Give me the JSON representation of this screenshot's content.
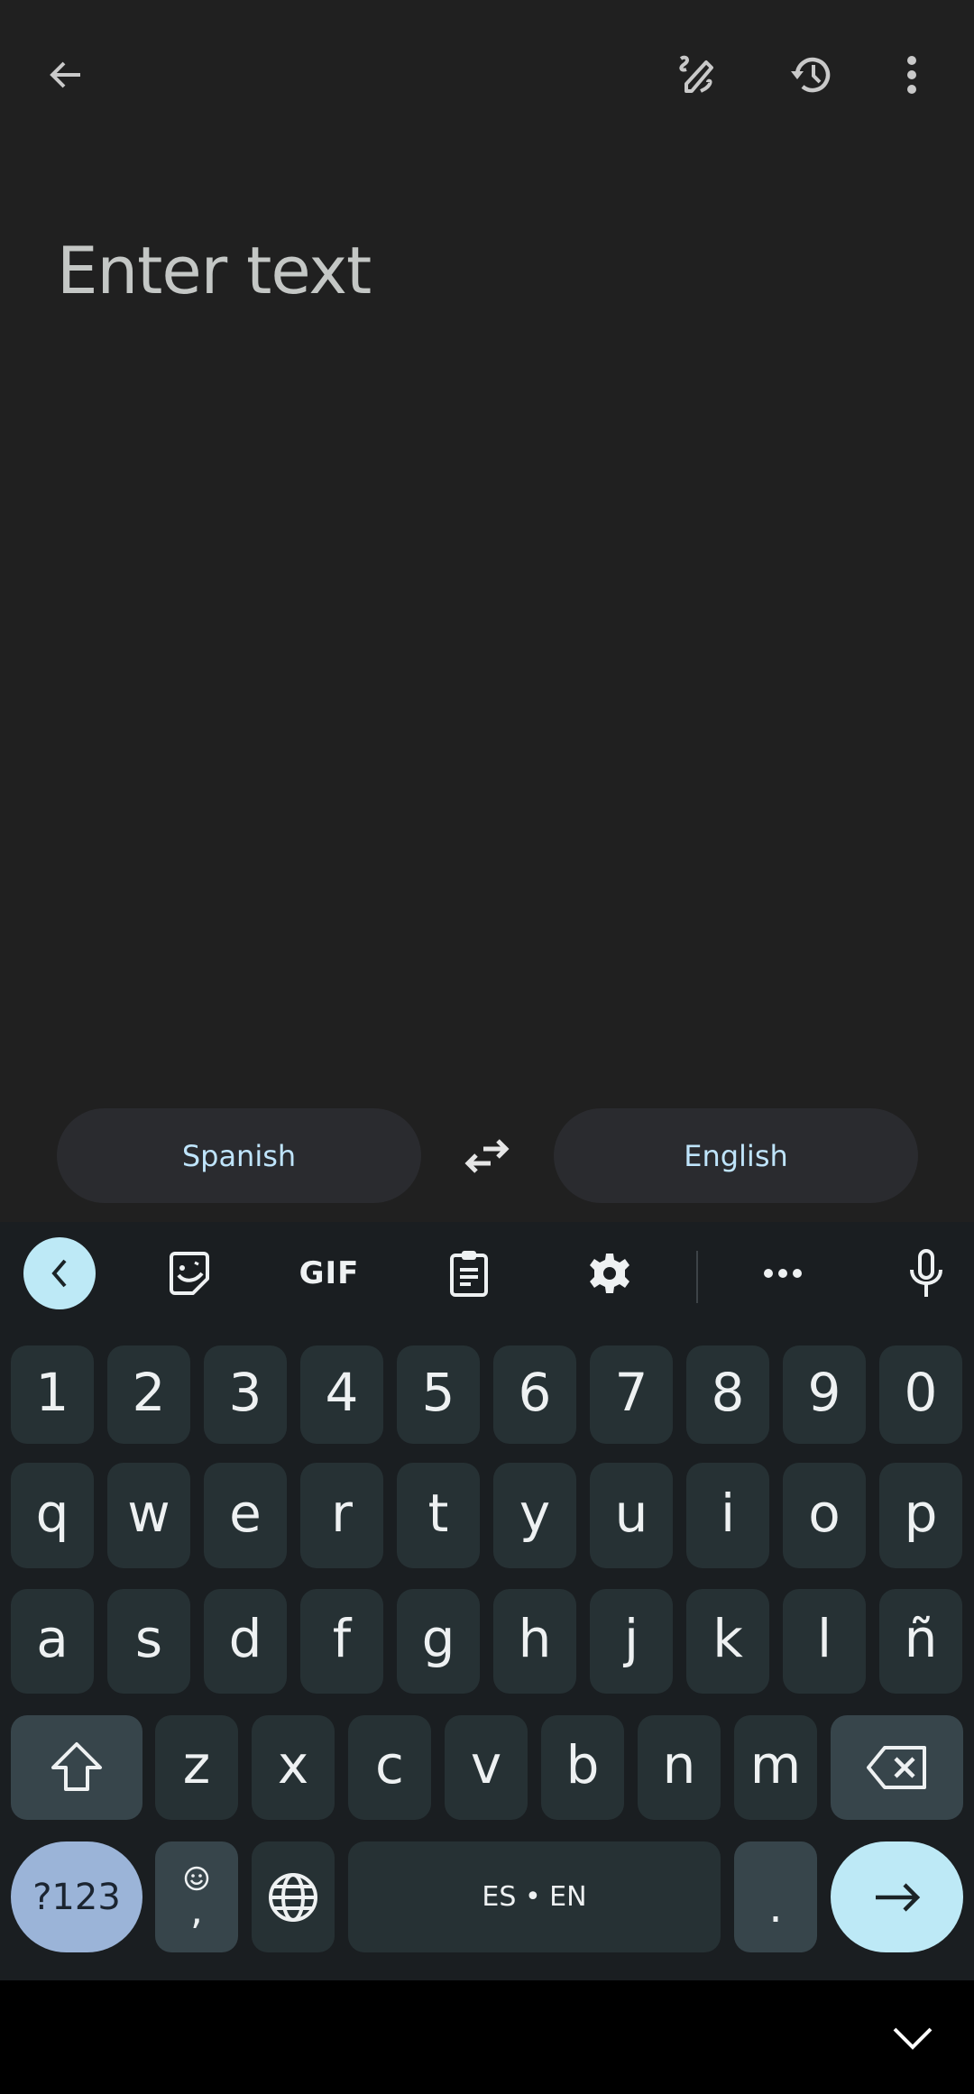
{
  "topbar": {
    "back_icon": "arrow-back-icon",
    "actions": [
      {
        "name": "handwriting-icon"
      },
      {
        "name": "history-icon"
      },
      {
        "name": "more-vert-icon"
      }
    ]
  },
  "input": {
    "placeholder": "Enter text",
    "value": ""
  },
  "languages": {
    "source": "Spanish",
    "target": "English",
    "swap_icon": "swap-arrows-icon"
  },
  "keyboard": {
    "toolbar": [
      {
        "name": "collapse-toolbar",
        "icon": "chevron-left-icon"
      },
      {
        "name": "sticker",
        "icon": "sticker-icon"
      },
      {
        "name": "gif",
        "label": "GIF"
      },
      {
        "name": "clipboard",
        "icon": "clipboard-icon"
      },
      {
        "name": "settings",
        "icon": "gear-icon"
      },
      {
        "name": "more",
        "icon": "more-horiz-icon"
      },
      {
        "name": "voice",
        "icon": "mic-icon"
      }
    ],
    "rows": {
      "numbers": [
        "1",
        "2",
        "3",
        "4",
        "5",
        "6",
        "7",
        "8",
        "9",
        "0"
      ],
      "row1": [
        "q",
        "w",
        "e",
        "r",
        "t",
        "y",
        "u",
        "i",
        "o",
        "p"
      ],
      "row2": [
        "a",
        "s",
        "d",
        "f",
        "g",
        "h",
        "j",
        "k",
        "l",
        "ñ"
      ],
      "row3": [
        "z",
        "x",
        "c",
        "v",
        "b",
        "n",
        "m"
      ]
    },
    "symbols_key": "?123",
    "comma_key": ",",
    "space_label": "ES • EN",
    "period_key": ".",
    "colors": {
      "accent_light_blue": "#bde9f6",
      "symbols_key_blue": "#9bb4d8",
      "key_bg": "#263134",
      "mod_key_bg": "#37454b",
      "keyboard_bg": "#1a1e21"
    }
  },
  "navbar": {
    "hide_keyboard_icon": "chevron-down-icon"
  }
}
